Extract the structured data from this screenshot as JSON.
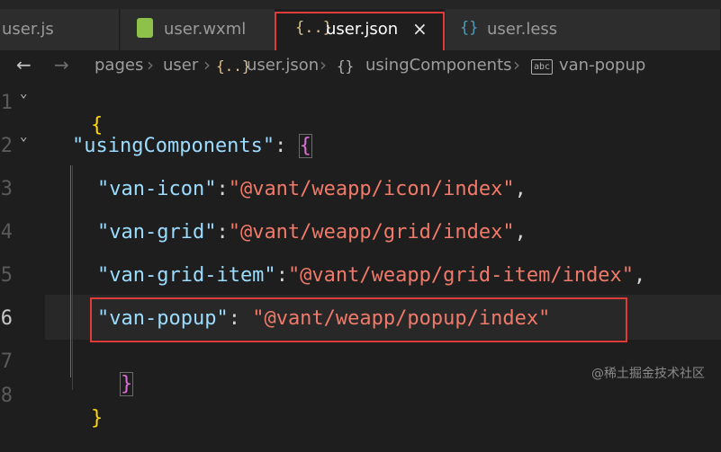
{
  "tabs": [
    {
      "label": "user.js",
      "icon": "js-file-icon",
      "icon_glyph": ""
    },
    {
      "label": "user.wxml",
      "icon": "wxml-file-icon",
      "icon_glyph": "</>"
    },
    {
      "label": "user.json",
      "icon": "json-file-icon",
      "icon_glyph": "{..}",
      "active": true,
      "close": "×"
    },
    {
      "label": "user.less",
      "icon": "less-file-icon",
      "icon_glyph": "{}"
    }
  ],
  "breadcrumb": {
    "back": "←",
    "forward": "→",
    "items": [
      "pages",
      "user",
      "user.json",
      "usingComponents",
      "van-popup"
    ],
    "sep": "›",
    "json_glyph": "{..}",
    "obj_glyph": "{}",
    "str_glyph": "abc"
  },
  "gutter": {
    "line_numbers": [
      "1",
      "2",
      "3",
      "4",
      "5",
      "6",
      "7",
      "8"
    ],
    "current_line": "6",
    "fold_glyph": "⌄"
  },
  "code": {
    "line1": "{",
    "line2_key": "\"usingComponents\"",
    "line2_colon": ": ",
    "line2_brace": "{",
    "line3_key": "\"van-icon\"",
    "line3_val": "\"@vant/weapp/icon/index\"",
    "line4_key": "\"van-grid\"",
    "line4_val": "\"@vant/weapp/grid/index\"",
    "line5_key": "\"van-grid-item\"",
    "line5_val": "\"@vant/weapp/grid-item/index\"",
    "line6_key": "\"van-popup\"",
    "line6_sep": ": ",
    "line6_val": "\"@vant/weapp/popup/index\"",
    "line7": "}",
    "line8": "}",
    "colon": ":",
    "comma": ","
  },
  "watermark": "@稀土掘金技术社区",
  "colors": {
    "highlight_box": "#e03b3b",
    "json_key": "#9cdcfe",
    "json_string": "#f07a6a",
    "bracket_outer": "#ffd700",
    "bracket_inner": "#da70d6"
  }
}
